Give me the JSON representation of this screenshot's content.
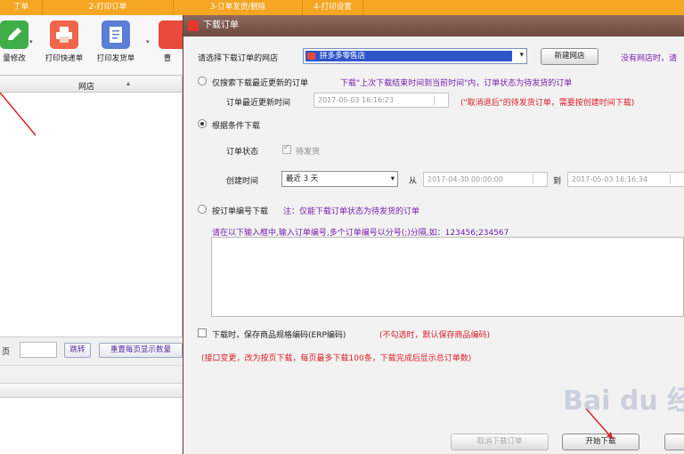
{
  "tabs": [
    "丁单",
    "2-打印订单",
    "3-订单发货/删除",
    "4-打印设置"
  ],
  "toolbar": {
    "buttons": [
      {
        "label": "量修改",
        "icon": "pencil-icon",
        "color": "#3fae49"
      },
      {
        "label": "打印快递单",
        "icon": "printer-icon",
        "color": "#f0664a"
      },
      {
        "label": "打印发货单",
        "icon": "document-icon",
        "color": "#5b7fd6"
      },
      {
        "label": "曹",
        "icon": "red-tool-icon",
        "color": "#e84a3c"
      }
    ]
  },
  "left_grid": {
    "column_header": "网店"
  },
  "pager": {
    "page_label": "页",
    "jump_button": "跳转",
    "reset_button": "重置每页显示数量"
  },
  "dialog": {
    "title": "下载订单",
    "select_store_label": "请选择下载订单的网店",
    "store_value": "拼多多零售店",
    "new_store_button": "新建网店",
    "no_store_hint": "没有网店时，请",
    "option_incremental": {
      "label": "仅搜索下载最近更新的订单",
      "hint": "下载\"上次下载结束时间到当前时间\"内，订单状态为待发货的订单",
      "time_label": "订单最近更新时间",
      "time_value": "2017-05-03 16:16:23",
      "time_note": "(\"取消退后\"的待发货订单，需要按创建时间下载)"
    },
    "option_condition": {
      "label": "根据条件下载",
      "status_label": "订单状态",
      "status_checkbox": "待发货",
      "created_label": "创建时间",
      "range_value": "最近 3 天",
      "from_label": "从",
      "from_value": "2017-04-30 00:00:00",
      "to_label": "到",
      "to_value": "2017-05-03 16:16:34"
    },
    "option_by_number": {
      "label": "按订单编号下载",
      "note": "注：仅能下载订单状态为待发货的订单",
      "instruction": "请在以下输入框中,输入订单编号,多个订单编号以分号(;)分隔,如：123456;234567"
    },
    "save_sku": {
      "label": "下载时，保存商品规格编码(ERP编码)",
      "note": "(不勾选时，默认保存商品编码)"
    },
    "api_note": "(接口变更，改为按页下载，每页最多下载100条，下载完成后显示总订单数)",
    "cancel_download_button": "取消下载订单",
    "start_download_button": "开始下载"
  },
  "watermark": "Bai du 经",
  "colors": {
    "tab_orange": "#f5a623",
    "dialog_title": "#7a5548",
    "store_select": "#2f56c9",
    "hint_red": "#d8202a",
    "hint_purple": "#7a1fb0"
  }
}
